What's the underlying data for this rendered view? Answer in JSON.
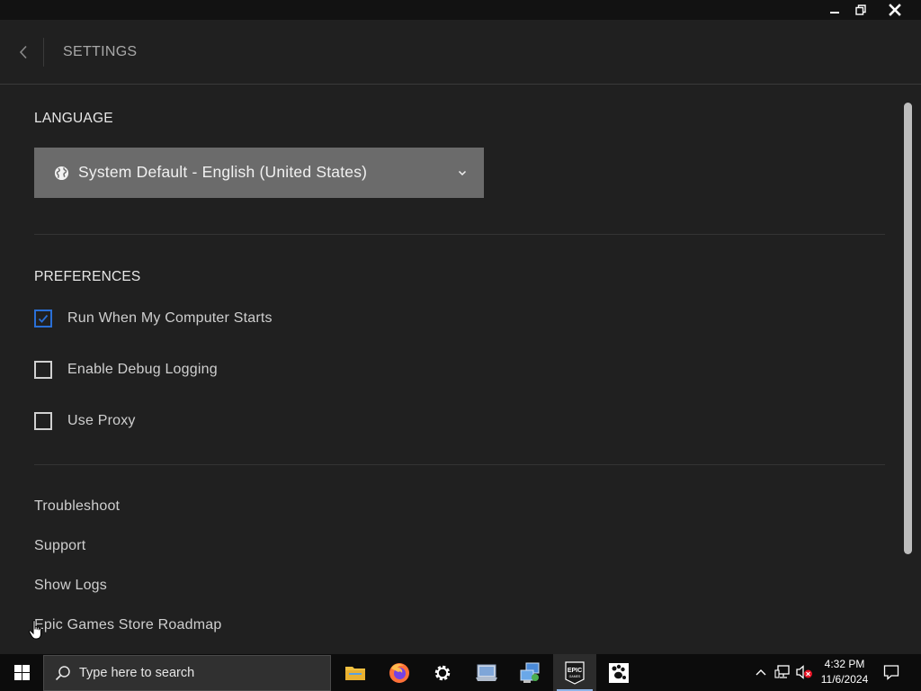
{
  "window": {
    "minimize_icon": "minimize-icon",
    "maximize_icon": "restore-icon",
    "close_icon": "close-icon"
  },
  "header": {
    "back_icon": "chevron-left-icon",
    "title": "SETTINGS"
  },
  "language": {
    "section_title": "LANGUAGE",
    "selected": "System Default - English (United States)",
    "icon": "globe-icon",
    "dropdown_icon": "chevron-down-icon"
  },
  "preferences": {
    "section_title": "PREFERENCES",
    "options": [
      {
        "label": "Run When My Computer Starts",
        "checked": true
      },
      {
        "label": "Enable Debug Logging",
        "checked": false
      },
      {
        "label": "Use Proxy",
        "checked": false
      }
    ]
  },
  "links": [
    "Troubleshoot",
    "Support",
    "Show Logs",
    "Epic Games Store Roadmap"
  ],
  "taskbar": {
    "search_placeholder": "Type here to search",
    "apps": [
      "file-explorer-icon",
      "firefox-icon",
      "settings-gear-icon",
      "control-panel-icon",
      "network-setup-icon",
      "epic-games-icon",
      "paw-app-icon"
    ],
    "active_app": "epic-games-icon",
    "time": "4:32 PM",
    "date": "11/6/2024"
  },
  "colors": {
    "background": "#202020",
    "accent_checkbox": "#2a6fd6",
    "select_bg": "#6b6b6b",
    "taskbar": "#0c0c0c"
  }
}
